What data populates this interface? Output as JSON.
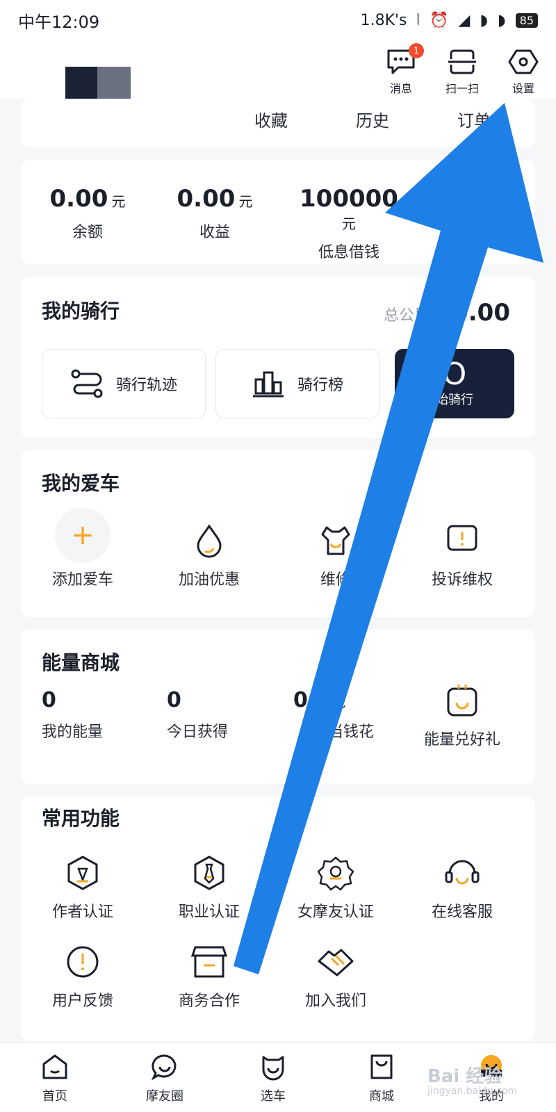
{
  "status_bar": {
    "time": "中午12:09",
    "net_speed": "1.8K's",
    "battery": "85"
  },
  "top_actions": [
    {
      "label": "消息",
      "icon": "message-icon",
      "badge": "1"
    },
    {
      "label": "扫一扫",
      "icon": "scan-icon"
    },
    {
      "label": "设置",
      "icon": "settings-icon"
    }
  ],
  "tabs": {
    "t1": "收藏",
    "t2": "历史",
    "t3": "订单"
  },
  "money": {
    "balance": {
      "value": "0.00",
      "unit": "元",
      "label": "余额"
    },
    "income": {
      "value": "0.00",
      "unit": "元",
      "label": "收益"
    },
    "loan": {
      "value": "100000",
      "unit": "元",
      "label": "低息借钱"
    }
  },
  "ride": {
    "title": "我的骑行",
    "total_label": "总公里数",
    "total_value": "0.00",
    "track_label": "骑行轨迹",
    "rank_label": "骑行榜",
    "start_glyph": "O",
    "start_label": "始骑行"
  },
  "car": {
    "title": "我的爱车",
    "items": [
      "添加爱车",
      "加油优惠",
      "维修",
      "投诉维权"
    ]
  },
  "energy": {
    "title": "能量商城",
    "my_energy": {
      "value": "0",
      "label": "我的能量"
    },
    "today": {
      "value": "0",
      "label": "今日获得"
    },
    "deduct": {
      "value": "0",
      "suffix": "元可抵",
      "label": "当钱花"
    },
    "exchange_label": "能量兑好礼"
  },
  "functions": {
    "title": "常用功能",
    "items": [
      "作者认证",
      "职业认证",
      "女摩友认证",
      "在线客服",
      "用户反馈",
      "商务合作",
      "加入我们"
    ]
  },
  "bottom_nav": [
    "首页",
    "摩友圈",
    "选车",
    "商城",
    "我的"
  ],
  "watermark": {
    "main": "Bai 经验",
    "sub": "jingyan.baidu.com"
  },
  "colors": {
    "accent": "#f5a623",
    "arrow": "#1e7fe6",
    "dark": "#17213a",
    "badge": "#f04b2e"
  }
}
